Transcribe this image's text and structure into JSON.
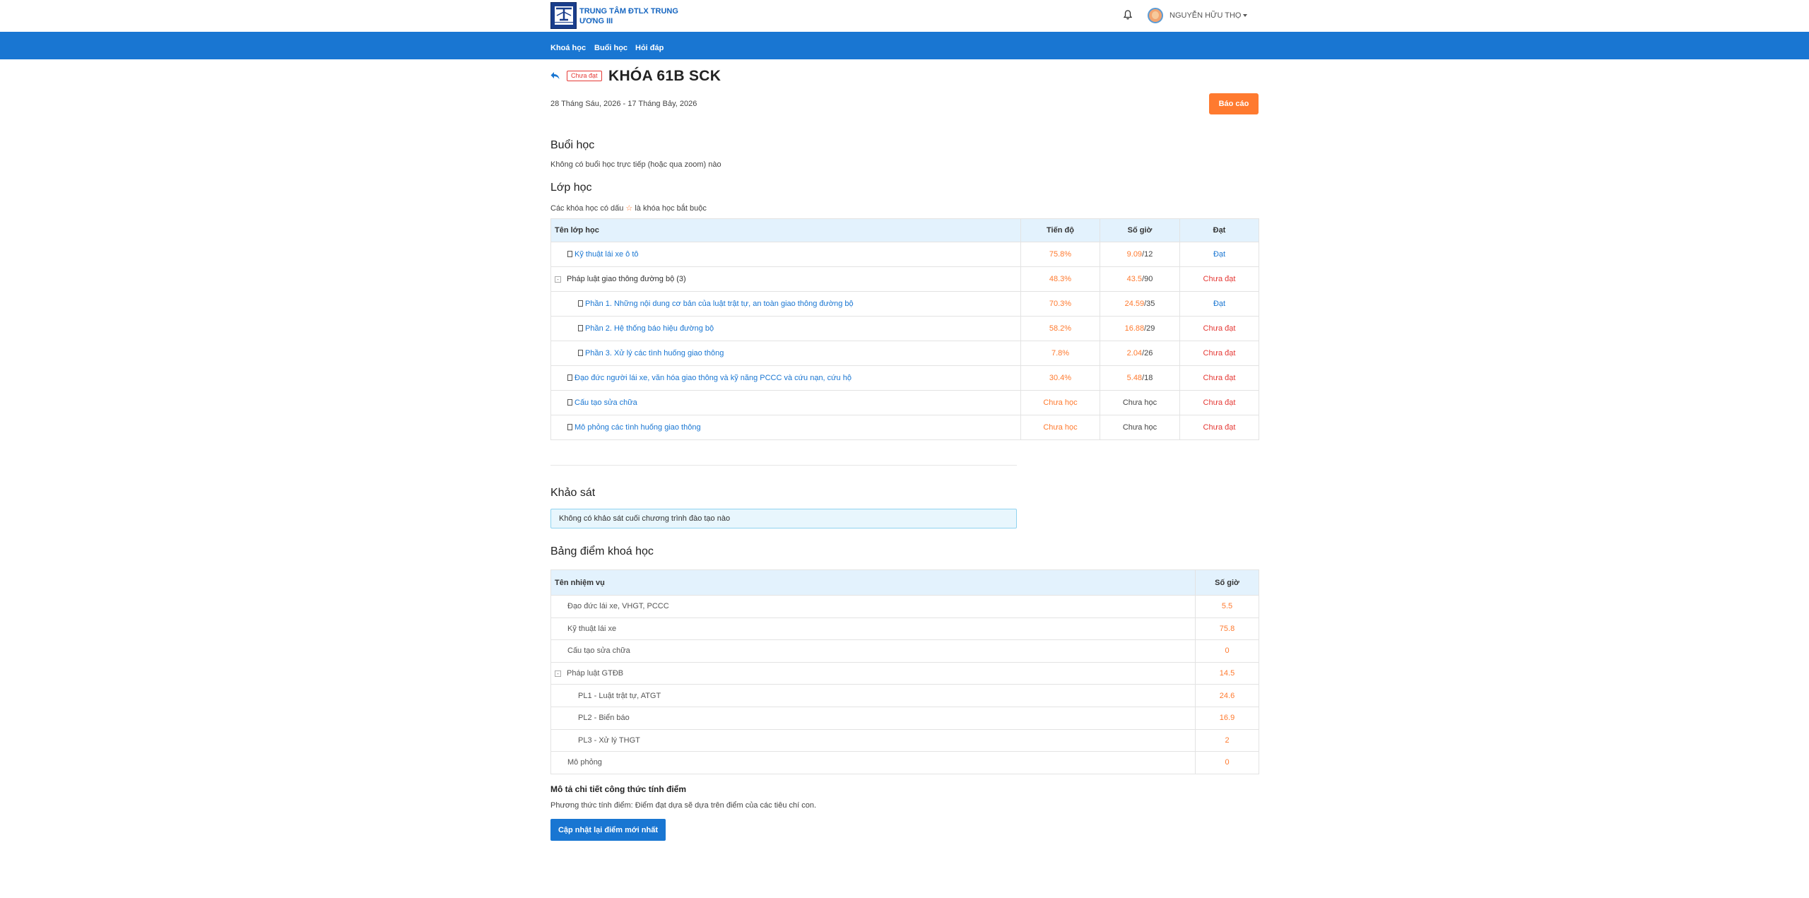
{
  "header": {
    "brand": "TRUNG TÂM ĐTLX TRUNG ƯƠNG III",
    "user_name": "NGUYỄN HỮU THỌ"
  },
  "nav": {
    "items": [
      {
        "label": "Khoá học"
      },
      {
        "label": "Buổi học"
      },
      {
        "label": "Hỏi đáp"
      }
    ]
  },
  "course": {
    "status_badge": "Chưa đạt",
    "title": "KHÓA 61B SCK",
    "date_range": "28 Tháng Sáu, 2026 - 17 Tháng Bảy, 2026",
    "report_button": "Báo cáo"
  },
  "sessions": {
    "title": "Buổi học",
    "empty_text": "Không có buổi học trực tiếp (hoặc qua zoom) nào"
  },
  "classes": {
    "title": "Lớp học",
    "note_prefix": "Các khóa học có dấu ",
    "note_star": "☆",
    "note_suffix": " là khóa học bắt buộc",
    "columns": {
      "name": "Tên lớp học",
      "progress": "Tiến độ",
      "hours": "Số giờ",
      "pass": "Đạt"
    },
    "rows": [
      {
        "name": "Kỹ thuật lái xe ô tô",
        "progress": "75.8%",
        "hours_done": "9.09",
        "hours_total": "/12",
        "pass": "Đạt"
      },
      {
        "name": "Pháp luật giao thông đường bộ",
        "count": "(3)",
        "progress": "48.3%",
        "hours_done": "43.5",
        "hours_total": "/90",
        "pass": "Chưa đạt"
      },
      {
        "name": "Phần 1. Những nội dung cơ bản của luật trật tự, an toàn giao thông đường bộ",
        "progress": "70.3%",
        "hours_done": "24.59",
        "hours_total": "/35",
        "pass": "Đạt"
      },
      {
        "name": "Phần 2. Hệ thống báo hiệu đường bộ",
        "progress": "58.2%",
        "hours_done": "16.88",
        "hours_total": "/29",
        "pass": "Chưa đạt"
      },
      {
        "name": "Phần 3. Xử lý các tình huống giao thông",
        "progress": "7.8%",
        "hours_done": "2.04",
        "hours_total": "/26",
        "pass": "Chưa đạt"
      },
      {
        "name": "Đạo đức người lái xe, văn hóa giao thông và kỹ năng PCCC và cứu nạn, cứu hộ",
        "progress": "30.4%",
        "hours_done": "5.48",
        "hours_total": "/18",
        "pass": "Chưa đạt"
      },
      {
        "name": "Cấu tạo sửa chữa",
        "progress": "Chưa học",
        "hours_text": "Chưa học",
        "pass": "Chưa đạt"
      },
      {
        "name": "Mô phỏng các tình huống giao thông",
        "progress": "Chưa học",
        "hours_text": "Chưa học",
        "pass": "Chưa đạt"
      }
    ]
  },
  "survey": {
    "title": "Khảo sát",
    "empty_text": "Không có khảo sát cuối chương trình đào tạo nào"
  },
  "scores": {
    "title": "Bảng điểm khoá học",
    "columns": {
      "name": "Tên nhiệm vụ",
      "hours": "Số giờ"
    },
    "rows": [
      {
        "name": "Đạo đức lái xe, VHGT, PCCC",
        "value": "5.5"
      },
      {
        "name": "Kỹ thuật lái xe",
        "value": "75.8"
      },
      {
        "name": "Cấu tạo sửa chữa",
        "value": "0"
      },
      {
        "name": "Pháp luật GTĐB",
        "value": "14.5"
      },
      {
        "name": "PL1 - Luật trật tự, ATGT",
        "value": "24.6"
      },
      {
        "name": "PL2 - Biển báo",
        "value": "16.9"
      },
      {
        "name": "PL3 - Xử lý THGT",
        "value": "2"
      },
      {
        "name": "Mô phỏng",
        "value": "0"
      }
    ],
    "formula_title": "Mô tả chi tiết công thức tính điểm",
    "formula_text": "Phương thức tính điểm: Điểm đạt dựa sẽ dựa trên điểm của các tiêu chí con.",
    "update_button": "Cập nhật lại điểm mới nhất"
  },
  "colors": {
    "primary": "#1976d2",
    "accent": "#ff7a2f",
    "danger": "#e53935"
  }
}
